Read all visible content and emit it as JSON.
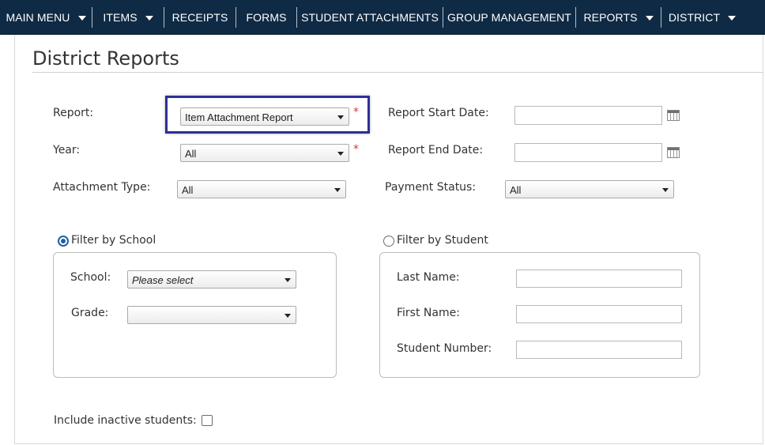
{
  "nav": {
    "items": [
      {
        "label": "MAIN MENU",
        "dropdown": true
      },
      {
        "label": "ITEMS",
        "dropdown": true
      },
      {
        "label": "RECEIPTS",
        "dropdown": false
      },
      {
        "label": "FORMS",
        "dropdown": false
      },
      {
        "label": "STUDENT ATTACHMENTS",
        "dropdown": false
      },
      {
        "label": "GROUP MANAGEMENT",
        "dropdown": false
      },
      {
        "label": "REPORTS",
        "dropdown": true
      },
      {
        "label": "DISTRICT",
        "dropdown": true
      }
    ]
  },
  "page": {
    "title": "District Reports"
  },
  "form": {
    "report": {
      "label": "Report:",
      "value": "Item Attachment Report",
      "required_mark": "*"
    },
    "year": {
      "label": "Year:",
      "value": "All",
      "required_mark": "*"
    },
    "attachment_type": {
      "label": "Attachment Type:",
      "value": "All"
    },
    "report_start_date": {
      "label": "Report Start Date:",
      "value": ""
    },
    "report_end_date": {
      "label": "Report End Date:",
      "value": ""
    },
    "payment_status": {
      "label": "Payment Status:",
      "value": "All"
    }
  },
  "filter_school": {
    "radio_label": "Filter by School",
    "selected": true,
    "school": {
      "label": "School:",
      "value": "Please select"
    },
    "grade": {
      "label": "Grade:",
      "value": ""
    }
  },
  "filter_student": {
    "radio_label": "Filter by Student",
    "selected": false,
    "last_name": {
      "label": "Last Name:",
      "value": ""
    },
    "first_name": {
      "label": "First Name:",
      "value": ""
    },
    "student_number": {
      "label": "Student Number:",
      "value": ""
    }
  },
  "include_inactive": {
    "label": "Include inactive students:",
    "checked": false
  },
  "colors": {
    "nav_background": "#0f2a44",
    "highlight_border": "#2d2f96",
    "required": "#d9363e",
    "radio_selected": "#1f5fa8"
  },
  "icons": {
    "calendar": "calendar-icon",
    "dropdown": "chevron-down-icon"
  }
}
